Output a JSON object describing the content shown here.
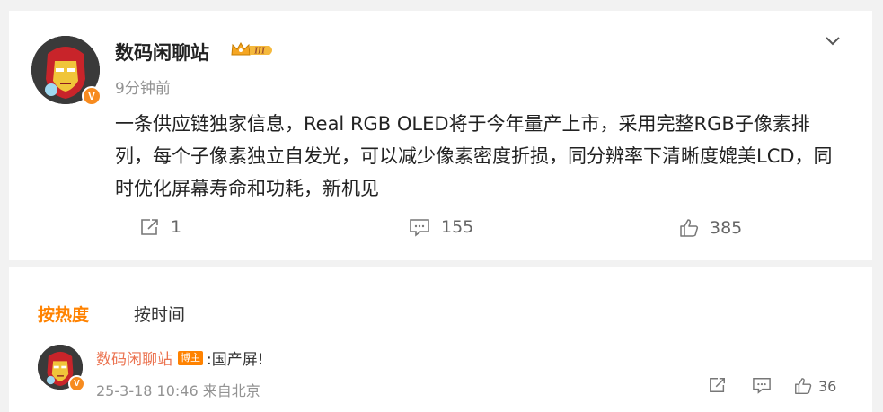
{
  "post": {
    "author": "数码闲聊站",
    "level_badge": "III",
    "time": "9分钟前",
    "verified_mark": "V",
    "text": "一条供应链独家信息，Real RGB OLED将于今年量产上市，采用完整RGB子像素排列，每个子像素独立自发光，可以减少像素密度折损，同分辨率下清晰度媲美LCD，同时优化屏幕寿命和功耗，新机见",
    "actions": {
      "share_count": "1",
      "comment_count": "155",
      "like_count": "385"
    }
  },
  "comments": {
    "tabs": {
      "hot": "按热度",
      "time": "按时间"
    },
    "items": [
      {
        "author": "数码闲聊站",
        "tag": "博主",
        "text": ":国产屏!",
        "verified_mark": "V",
        "meta": "25-3-18 10:46 来自北京",
        "like_count": "36"
      }
    ]
  },
  "colors": {
    "accent": "#ff8200",
    "name_link": "#eb7350",
    "verified": "#f78b1f",
    "muted": "#939393"
  },
  "icons": [
    "chevron-down-icon",
    "crown-badge-icon",
    "share-icon",
    "comment-icon",
    "like-icon"
  ]
}
